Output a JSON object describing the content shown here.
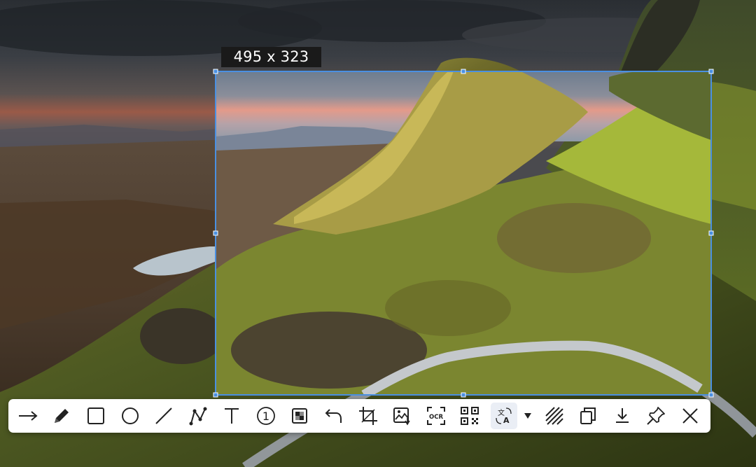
{
  "selection": {
    "size_readout": "495 x 323"
  },
  "toolbar": {
    "tools": [
      {
        "id": "arrow",
        "label": "Arrow",
        "icon": "arrow-right-icon"
      },
      {
        "id": "pencil",
        "label": "Pencil",
        "icon": "pencil-icon"
      },
      {
        "id": "rectangle",
        "label": "Rectangle",
        "icon": "rectangle-icon"
      },
      {
        "id": "ellipse",
        "label": "Ellipse",
        "icon": "circle-icon"
      },
      {
        "id": "line",
        "label": "Line",
        "icon": "line-icon"
      },
      {
        "id": "polyline",
        "label": "Polyline",
        "icon": "polyline-icon"
      },
      {
        "id": "text",
        "label": "Text",
        "icon": "text-icon"
      },
      {
        "id": "number",
        "label": "Serial number",
        "icon": "number-badge-icon",
        "glyph": "1"
      },
      {
        "id": "mosaic",
        "label": "Mosaic",
        "icon": "mosaic-icon"
      },
      {
        "id": "undo",
        "label": "Undo",
        "icon": "undo-icon"
      },
      {
        "id": "crop",
        "label": "Crop",
        "icon": "crop-icon"
      },
      {
        "id": "image-adjust",
        "label": "Image",
        "icon": "image-edit-icon"
      },
      {
        "id": "ocr",
        "label": "OCR",
        "icon": "ocr-icon",
        "glyph": "OCR"
      },
      {
        "id": "qr",
        "label": "QR code",
        "icon": "qr-code-icon"
      },
      {
        "id": "translate",
        "label": "Translate",
        "icon": "translate-icon",
        "active": true
      },
      {
        "id": "translate-options",
        "label": "Translate options",
        "icon": "dropdown-triangle-icon"
      },
      {
        "id": "hatch",
        "label": "Hatch",
        "icon": "hatch-icon"
      },
      {
        "id": "copy",
        "label": "Copy",
        "icon": "copy-icon"
      },
      {
        "id": "save",
        "label": "Save",
        "icon": "download-icon"
      },
      {
        "id": "pin",
        "label": "Pin",
        "icon": "pin-icon"
      },
      {
        "id": "close",
        "label": "Close",
        "icon": "close-icon"
      }
    ]
  },
  "colors": {
    "selection_border": "#4a90e2",
    "toolbar_bg": "#ffffff",
    "icon": "#222222",
    "readout_bg": "#1a1a1a"
  }
}
